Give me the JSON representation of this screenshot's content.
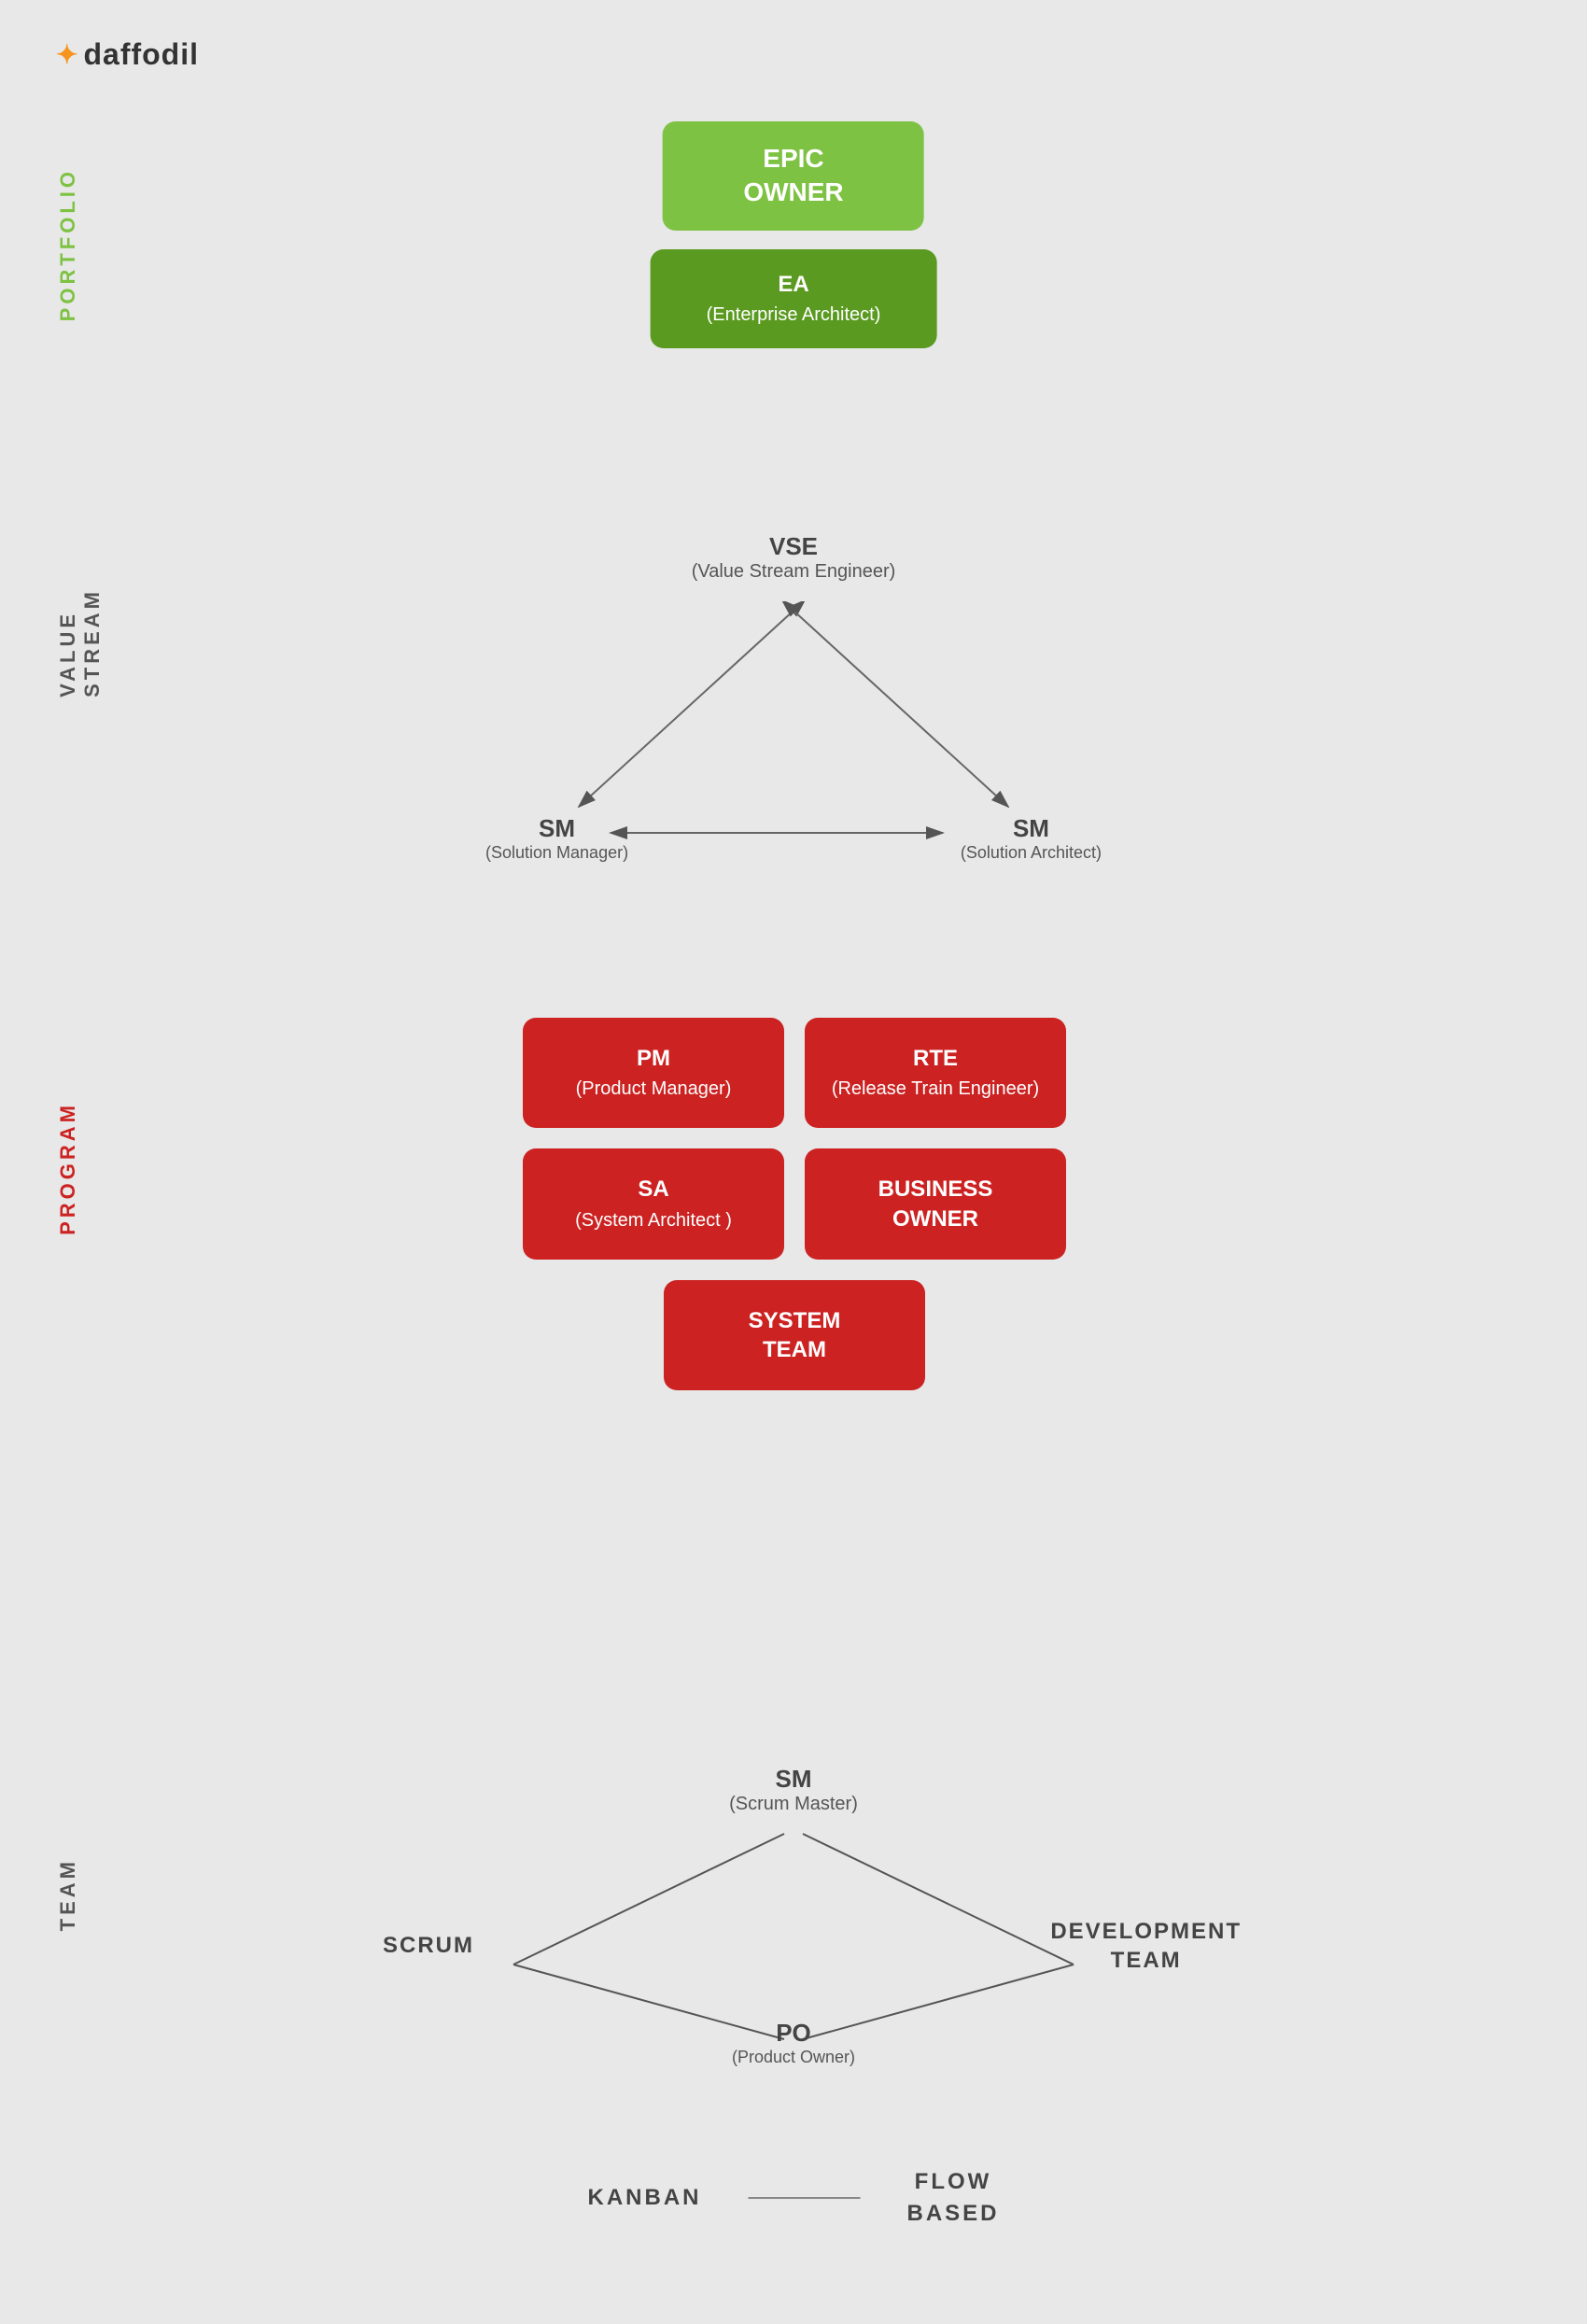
{
  "logo": {
    "icon": "✦",
    "text": "daffodil"
  },
  "sections": {
    "portfolio": {
      "label": "PORTFOLIO",
      "epic_owner": "EPIC\nOWNER",
      "ea_title": "EA",
      "ea_sub": "(Enterprise Architect)"
    },
    "value_stream": {
      "label": "VALUE\nSTREAM",
      "vse_title": "VSE",
      "vse_sub": "(Value Stream Engineer)",
      "sm_left_title": "SM",
      "sm_left_sub": "(Solution Manager)",
      "sm_right_title": "SM",
      "sm_right_sub": "(Solution Architect)"
    },
    "program": {
      "label": "PROGRAM",
      "pm_title": "PM",
      "pm_sub": "(Product Manager)",
      "rte_title": "RTE",
      "rte_sub": "(Release Train Engineer)",
      "sa_title": "SA",
      "sa_sub": "(System Architect )",
      "bo_title": "BUSINESS\nOWNER",
      "st_title": "SYSTEM\nTEAM"
    },
    "team": {
      "label": "TEAM",
      "sm_title": "SM",
      "sm_sub": "(Scrum Master)",
      "scrum_label": "SCRUM",
      "po_title": "PO",
      "po_sub": "(Product Owner)",
      "devteam_label": "DEVELOPMENT\nTEAM",
      "kanban_label": "KANBAN",
      "flow_label": "FLOW\nBASED"
    }
  },
  "colors": {
    "green_bright": "#7dc242",
    "green_dark": "#5a9a20",
    "red": "#cc2222",
    "bg": "#e8e8e8",
    "text_dark": "#444444",
    "text_mid": "#666666",
    "logo_orange": "#f7941d"
  }
}
